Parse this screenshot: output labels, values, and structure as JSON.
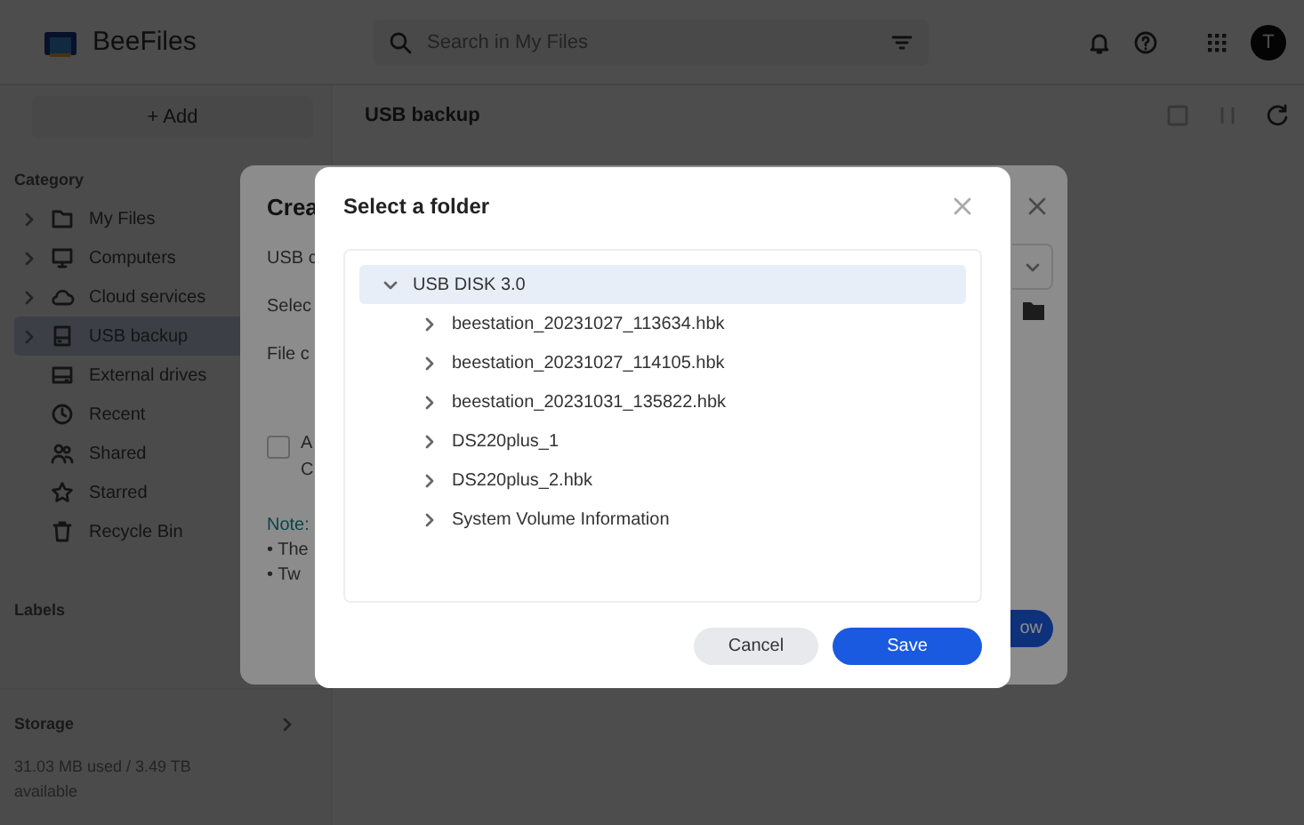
{
  "app": {
    "name": "BeeFiles"
  },
  "search": {
    "placeholder": "Search in My Files"
  },
  "user": {
    "initial": "T"
  },
  "sidebar": {
    "add_button": "+ Add",
    "category_heading": "Category",
    "items": [
      {
        "label": "My Files",
        "kind": "folder",
        "expandable": true,
        "selected": false
      },
      {
        "label": "Computers",
        "kind": "computer",
        "expandable": true,
        "selected": false
      },
      {
        "label": "Cloud services",
        "kind": "cloud",
        "expandable": true,
        "selected": false
      },
      {
        "label": "USB backup",
        "kind": "drive",
        "expandable": true,
        "selected": true
      },
      {
        "label": "External drives",
        "kind": "external",
        "expandable": false,
        "selected": false
      },
      {
        "label": "Recent",
        "kind": "clock",
        "expandable": false,
        "selected": false
      },
      {
        "label": "Shared",
        "kind": "people",
        "expandable": false,
        "selected": false
      },
      {
        "label": "Starred",
        "kind": "star",
        "expandable": false,
        "selected": false
      },
      {
        "label": "Recycle Bin",
        "kind": "trash",
        "expandable": false,
        "selected": false
      }
    ],
    "labels_heading": "Labels",
    "storage": {
      "heading": "Storage",
      "usage": "31.03 MB used / 3.49 TB available"
    }
  },
  "main": {
    "title": "USB backup"
  },
  "create_dialog": {
    "title": "Crea",
    "fields": [
      "USB c",
      "Selec",
      "File c"
    ],
    "checkbox": {
      "checked": false,
      "lines": [
        "A",
        "C"
      ]
    },
    "note": "Note:",
    "bullets": [
      "• The",
      "• Tw"
    ],
    "primary_button": "ow"
  },
  "folder_dialog": {
    "title": "Select a folder",
    "tree": [
      {
        "label": "USB DISK 3.0",
        "expanded": true,
        "selected": true,
        "children": [
          {
            "label": "beestation_20231027_113634.hbk",
            "expanded": false,
            "selected": false
          },
          {
            "label": "beestation_20231027_114105.hbk",
            "expanded": false,
            "selected": false
          },
          {
            "label": "beestation_20231031_135822.hbk",
            "expanded": false,
            "selected": false
          },
          {
            "label": "DS220plus_1",
            "expanded": false,
            "selected": false
          },
          {
            "label": "DS220plus_2.hbk",
            "expanded": false,
            "selected": false
          },
          {
            "label": "System Volume Information",
            "expanded": false,
            "selected": false
          }
        ]
      }
    ],
    "buttons": [
      {
        "label": "Cancel",
        "kind": "secondary"
      },
      {
        "label": "Save",
        "kind": "primary"
      }
    ]
  }
}
